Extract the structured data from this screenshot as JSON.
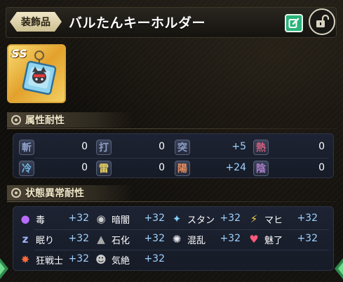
{
  "header": {
    "category": "装飾品",
    "item_name": "バルたんキーホルダー"
  },
  "item": {
    "rarity": "SS"
  },
  "attribute_resistance": {
    "title": "属性耐性",
    "rows": [
      [
        {
          "icon": "slash-icon",
          "glyph": "斬",
          "color": "#8fa0c8",
          "value": "0"
        },
        {
          "icon": "strike-icon",
          "glyph": "打",
          "color": "#8fa0c8",
          "value": "0"
        },
        {
          "icon": "pierce-icon",
          "glyph": "突",
          "color": "#8fa0c8",
          "value": "+5"
        },
        {
          "icon": "heat-icon",
          "glyph": "熱",
          "color": "#d06080",
          "value": "0"
        }
      ],
      [
        {
          "icon": "cold-icon",
          "glyph": "冷",
          "color": "#70b8e8",
          "value": "0"
        },
        {
          "icon": "thunder-icon",
          "glyph": "雷",
          "color": "#e8d060",
          "value": "0"
        },
        {
          "icon": "light-icon",
          "glyph": "陽",
          "color": "#e89060",
          "value": "+24"
        },
        {
          "icon": "dark-icon",
          "glyph": "陰",
          "color": "#b080d0",
          "value": "0"
        }
      ]
    ]
  },
  "status_resistance": {
    "title": "状態異常耐性",
    "rows": [
      [
        {
          "icon": "poison-icon",
          "label": "毒",
          "value": "+32"
        },
        {
          "icon": "darkness-icon",
          "label": "暗闇",
          "value": "+32"
        },
        {
          "icon": "stun-icon",
          "label": "スタン",
          "value": "+32"
        },
        {
          "icon": "paralysis-icon",
          "label": "マヒ",
          "value": "+32"
        }
      ],
      [
        {
          "icon": "sleep-icon",
          "label": "眠り",
          "value": "+32"
        },
        {
          "icon": "petrify-icon",
          "label": "石化",
          "value": "+32"
        },
        {
          "icon": "confusion-icon",
          "label": "混乱",
          "value": "+32"
        },
        {
          "icon": "charm-icon",
          "label": "魅了",
          "value": "+32"
        }
      ],
      [
        {
          "icon": "berserk-icon",
          "label": "狂戦士",
          "value": "+32"
        },
        {
          "icon": "faint-icon",
          "label": "気絶",
          "value": "+32"
        }
      ]
    ]
  },
  "colors": {
    "positive_value": "#9fd2ff",
    "accent_gold": "#d9a63a",
    "edit_green": "#2bb37a"
  }
}
